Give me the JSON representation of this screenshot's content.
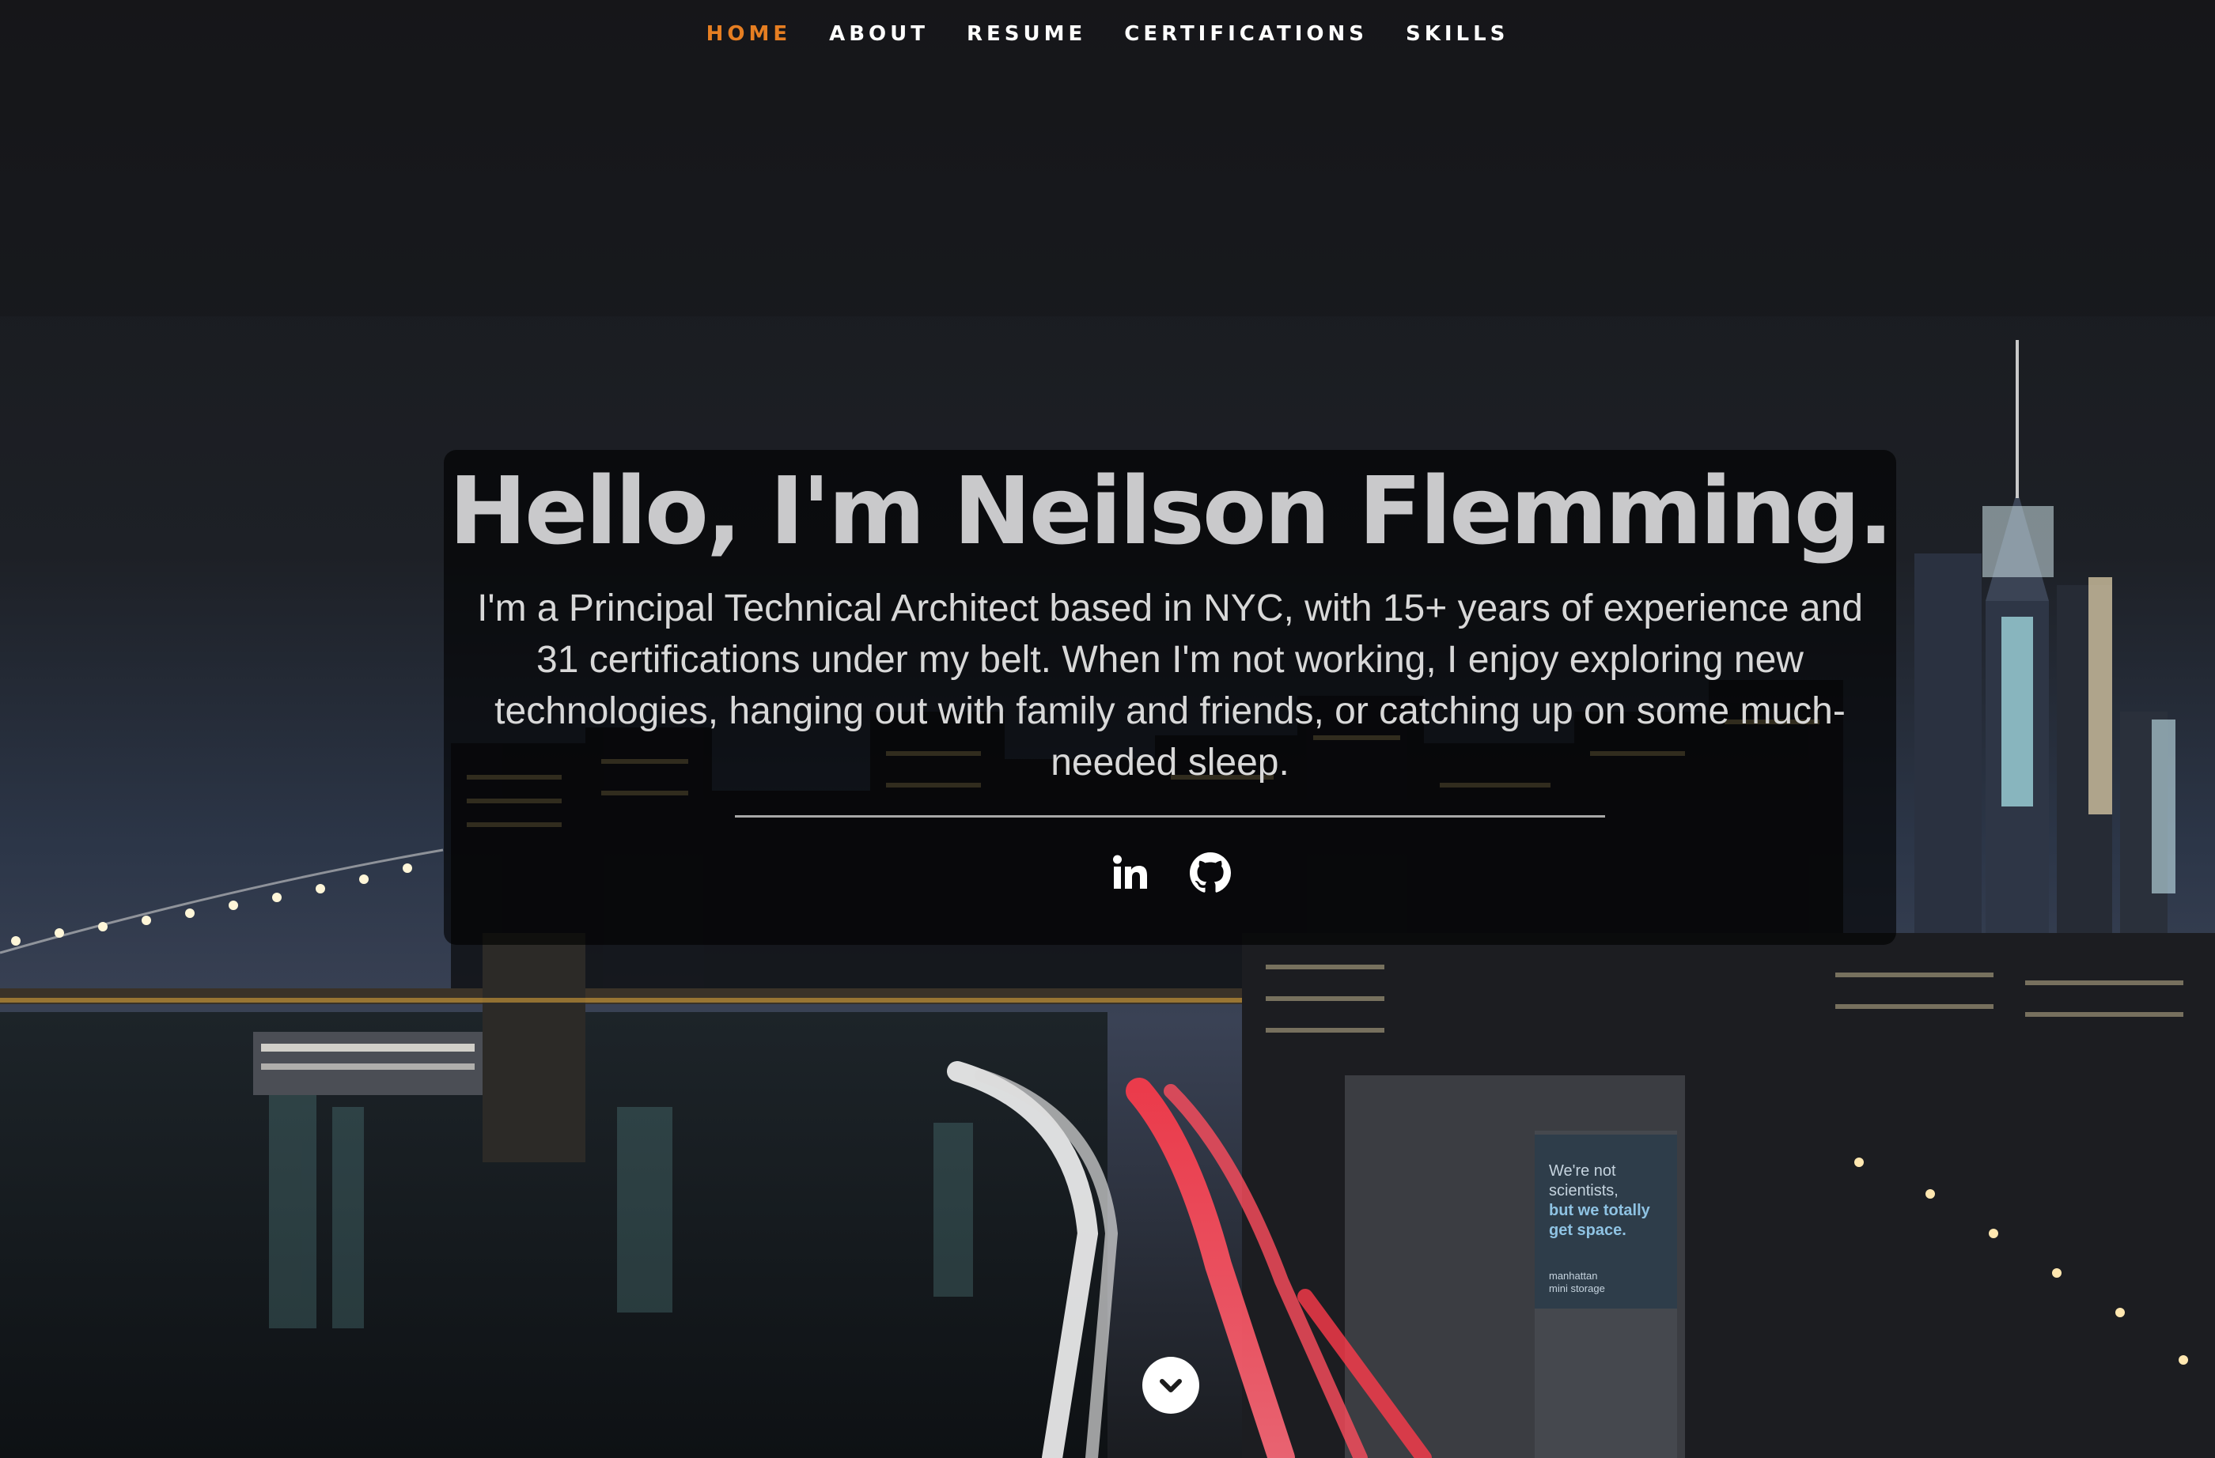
{
  "nav": {
    "items": [
      {
        "label": "HOME",
        "active": true
      },
      {
        "label": "ABOUT",
        "active": false
      },
      {
        "label": "RESUME",
        "active": false
      },
      {
        "label": "CERTIFICATIONS",
        "active": false
      },
      {
        "label": "SKILLS",
        "active": false
      }
    ],
    "accent_color": "#e67e22"
  },
  "hero": {
    "title": "Hello, I'm Neilson Flemming.",
    "description": "I'm a Principal Technical Architect based in NYC, with 15+ years of experience and 31 certifications under my belt. When I'm not working, I enjoy exploring new technologies, hanging out with family and friends, or catching up on some much-needed sleep.",
    "background": "night city skyline with bridge and light-trail highway"
  },
  "billboard": {
    "lines": [
      "We're not",
      "scientists,",
      "but we totally",
      "get space.",
      "manhattan",
      "mini storage"
    ]
  },
  "social": [
    {
      "name": "linkedin",
      "icon": "linkedin-icon"
    },
    {
      "name": "github",
      "icon": "github-icon"
    }
  ],
  "scroll_button": {
    "icon": "chevron-down-icon"
  }
}
